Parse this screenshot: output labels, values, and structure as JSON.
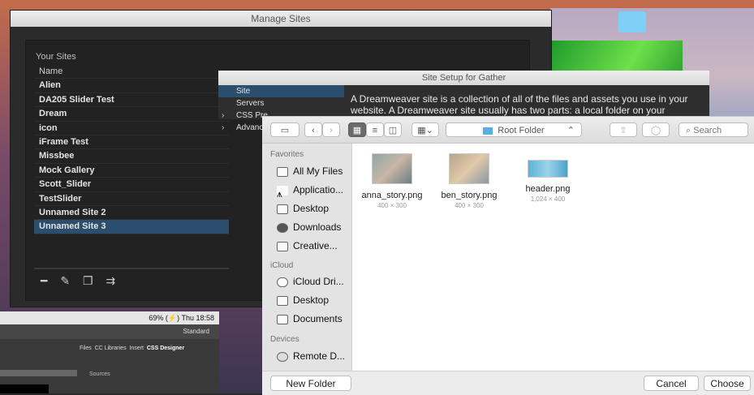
{
  "manage_sites": {
    "title": "Manage Sites",
    "your_sites_label": "Your Sites",
    "column_name": "Name",
    "sites": [
      "Alien",
      "DA205 Slider Test",
      "Dream",
      "icon",
      "iFrame Test",
      "Missbee",
      "Mock Gallery",
      "Scott_Slider",
      "TestSlider",
      "Unnamed Site 2",
      "Unnamed Site 3"
    ],
    "selected_site": "Unnamed Site 3",
    "tools": [
      "remove-icon",
      "edit-icon",
      "duplicate-icon",
      "export-icon"
    ]
  },
  "site_setup": {
    "title": "Site Setup for Gather",
    "categories": [
      "Site",
      "Servers",
      "CSS Pre",
      "Advance"
    ],
    "selected_category": "Site",
    "description": "A Dreamweaver site is a collection of all of the files and assets you use in your website. A Dreamweaver site usually has two parts: a local folder on your"
  },
  "open_dialog": {
    "location": "Root Folder",
    "search_placeholder": "Search",
    "favorites_label": "Favorites",
    "favorites": [
      "All My Files",
      "Applicatio...",
      "Desktop",
      "Downloads",
      "Creative..."
    ],
    "icloud_label": "iCloud",
    "icloud": [
      "iCloud Dri...",
      "Desktop",
      "Documents"
    ],
    "devices_label": "Devices",
    "devices": [
      "Remote D..."
    ],
    "files": [
      {
        "name": "anna_story.png",
        "size": "400 × 300"
      },
      {
        "name": "ben_story.png",
        "size": "400 × 300"
      },
      {
        "name": "header.png",
        "size": "1,024 × 400"
      }
    ],
    "new_folder": "New Folder",
    "cancel": "Cancel",
    "choose": "Choose"
  },
  "dw_window": {
    "menubar_status": "69% (⚡)   Thu 18:58",
    "workspace": "Standard",
    "panel_tabs": [
      "Files",
      "CC Libraries",
      "Insert",
      "CSS Designer"
    ],
    "sources_label": "Sources"
  }
}
